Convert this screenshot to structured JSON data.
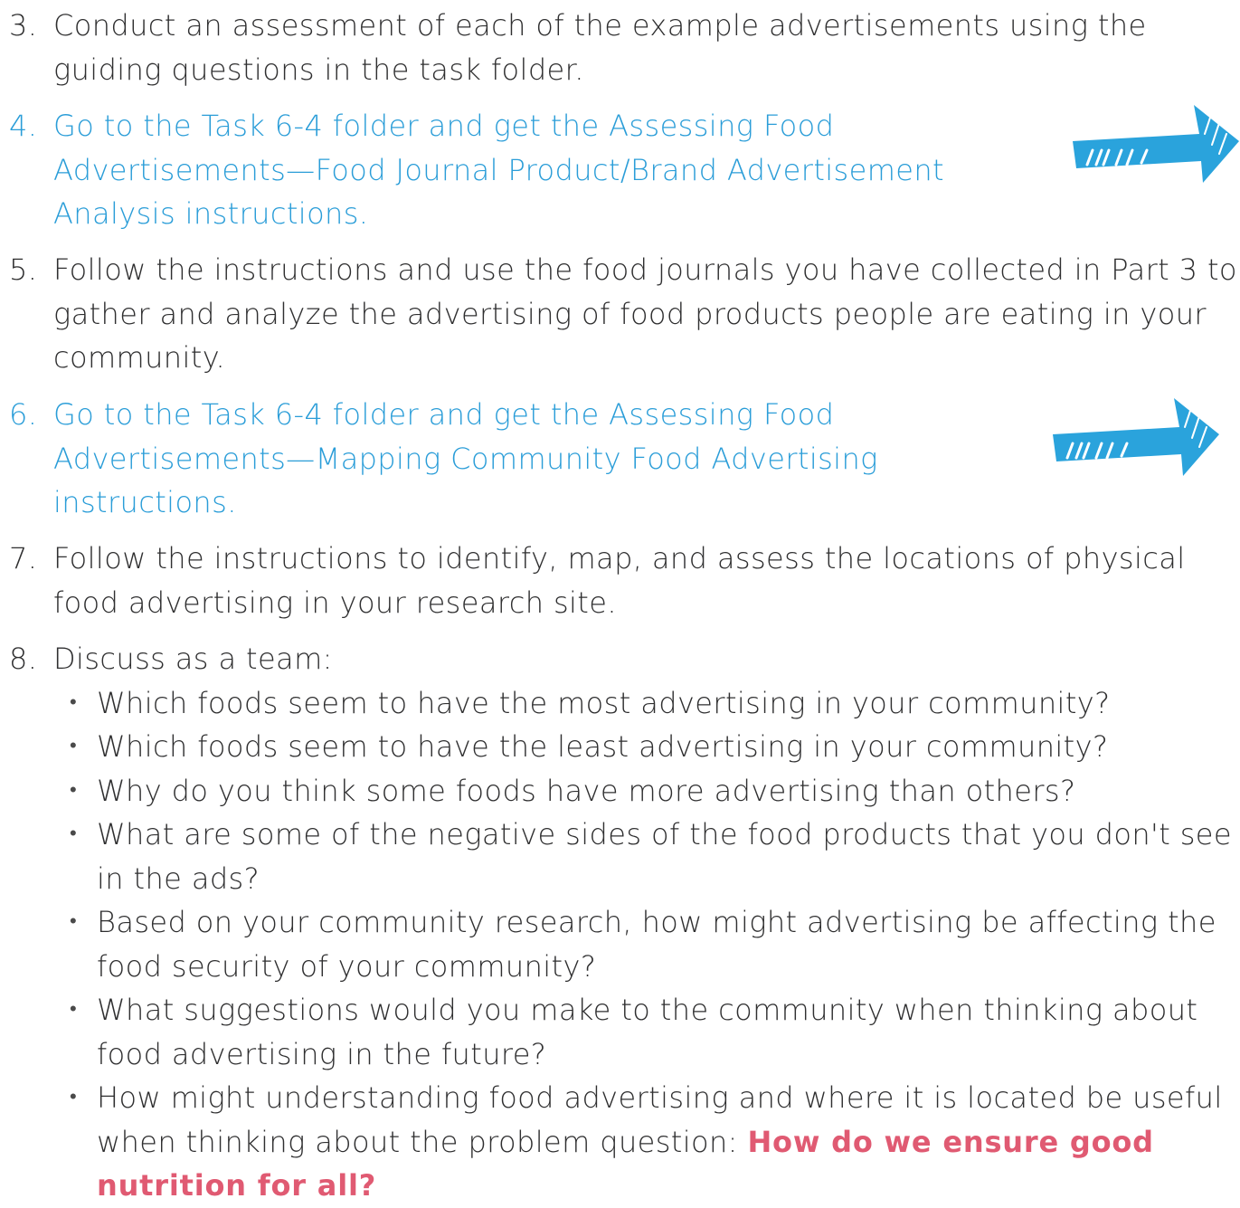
{
  "steps": [
    {
      "num": "3.",
      "text": "Conduct an assessment of each of the example advertisements using the guiding questions in the task folder."
    },
    {
      "num": "4.",
      "text": "Go to the Task 6-4 folder and get the Assessing Food Advertisements—Food Journal Product/Brand Advertisement Analysis instructions."
    },
    {
      "num": "5.",
      "text": "Follow the instructions and use the food journals you have collected in Part 3 to gather and analyze the advertising of food products people are eating in your community."
    },
    {
      "num": "6.",
      "text": "Go to the Task 6-4 folder and get the Assessing Food Advertisements—Mapping Community Food Advertising instructions."
    },
    {
      "num": "7.",
      "text": "Follow the instructions to identify, map, and assess the locations of physical food advertising in your research site."
    },
    {
      "num": "8.",
      "text": "Discuss as a team:"
    }
  ],
  "bullet_char": "•",
  "bullets": [
    "Which foods seem to have the most advertising in your community?",
    "Which foods seem to have the least advertising in your community?",
    "Why do you think some foods have more advertising than others?",
    "What are some of the negative sides of the food products that you don't see in the ads?",
    "Based on your community research, how might advertising be affecting the food security of your community?",
    "What suggestions would you make to the community when thinking about food advertising in the future?",
    "How might understanding food advertising and where it is located be useful when thinking about the problem question:"
  ],
  "problem_question": "How do we ensure good nutrition for all?",
  "icons": {
    "link_arrow": "arrow-right-icon"
  },
  "colors": {
    "text": "#2f2f30",
    "link": "#2a9dd8",
    "arrow": "#2aa3dc",
    "emphasis": "#e05a72"
  }
}
